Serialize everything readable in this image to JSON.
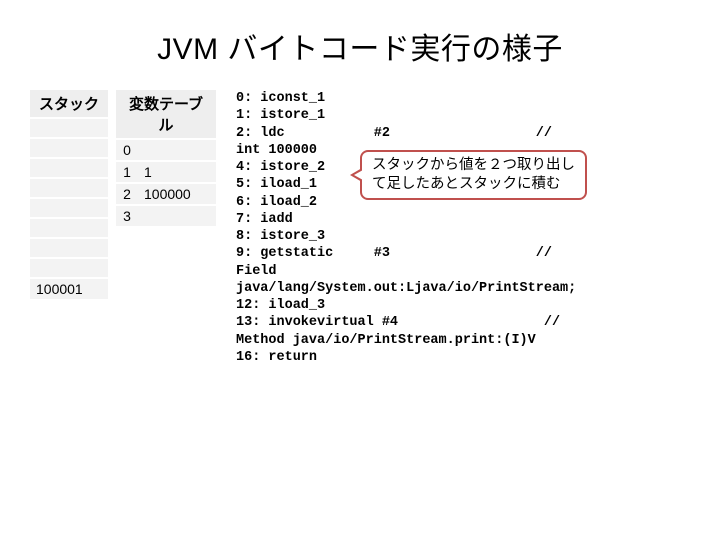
{
  "title": "JVM バイトコード実行の様子",
  "stack": {
    "header": "スタック",
    "cells": [
      "",
      "",
      "",
      "",
      "",
      "",
      "",
      "",
      "100001"
    ]
  },
  "vars": {
    "header": "変数テーブル",
    "rows": [
      {
        "idx": "0",
        "val": ""
      },
      {
        "idx": "1",
        "val": "1"
      },
      {
        "idx": "2",
        "val": "100000"
      },
      {
        "idx": "3",
        "val": ""
      }
    ]
  },
  "callout": {
    "line1": "スタックから値を２つ取り出し",
    "line2": "て足したあとスタックに積む"
  },
  "code": "0: iconst_1\n1: istore_1\n2: ldc           #2                  //\nint 100000\n4: istore_2\n5: iload_1\n6: iload_2\n7: iadd\n8: istore_3\n9: getstatic     #3                  //\nField\njava/lang/System.out:Ljava/io/PrintStream;\n12: iload_3\n13: invokevirtual #4                  //\nMethod java/io/PrintStream.print:(I)V\n16: return"
}
